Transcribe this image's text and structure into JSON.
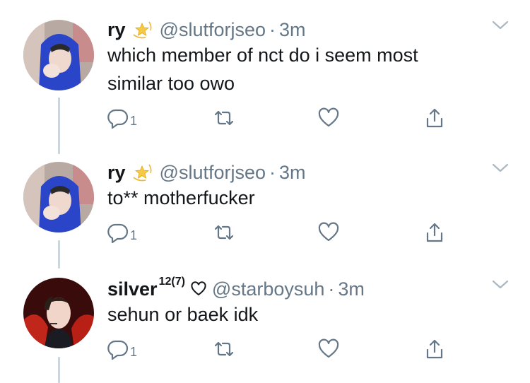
{
  "tweets": [
    {
      "name": "ry",
      "name_icon": "dizzy-emoji-icon",
      "handle": "@slutforjseo",
      "sep": "·",
      "time": "3m",
      "text_line1": "which member of nct do i seem most",
      "text_line2": "similar too owo",
      "reply_count": "1"
    },
    {
      "name": "ry",
      "name_icon": "dizzy-emoji-icon",
      "handle": "@slutforjseo",
      "sep": "·",
      "time": "3m",
      "text_line1": "to** motherfucker",
      "reply_count": "1"
    },
    {
      "name": "silver",
      "name_sup": "12(7)",
      "name_icon": "heart-outline-icon",
      "handle": "@starboysuh",
      "sep": "·",
      "time": "3m",
      "text_line1": "sehun or baek idk",
      "reply_count": "1"
    }
  ],
  "colors": {
    "text": "#14171a",
    "muted": "#657786",
    "thread_line": "#ccd6dd"
  }
}
